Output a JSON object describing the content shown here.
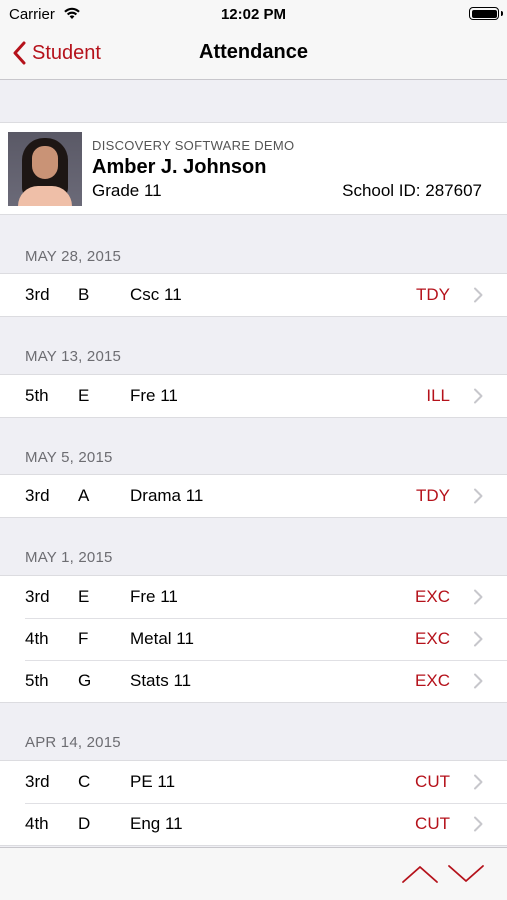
{
  "status_bar": {
    "carrier": "Carrier",
    "time": "12:02 PM",
    "battery_level": 1.0
  },
  "nav": {
    "back_label": "Student",
    "title": "Attendance"
  },
  "student": {
    "school": "DISCOVERY SOFTWARE DEMO",
    "name": "Amber J. Johnson",
    "grade": "Grade 11",
    "school_id": "School ID: 287607"
  },
  "sections": [
    {
      "date": "MAY 28, 2015",
      "rows": [
        {
          "period": "3rd",
          "block": "B",
          "course": "Csc 11",
          "code": "TDY"
        }
      ]
    },
    {
      "date": "MAY 13, 2015",
      "rows": [
        {
          "period": "5th",
          "block": "E",
          "course": "Fre 11",
          "code": "ILL"
        }
      ]
    },
    {
      "date": "MAY 5, 2015",
      "rows": [
        {
          "period": "3rd",
          "block": "A",
          "course": "Drama 11",
          "code": "TDY"
        }
      ]
    },
    {
      "date": "MAY 1, 2015",
      "rows": [
        {
          "period": "3rd",
          "block": "E",
          "course": "Fre 11",
          "code": "EXC"
        },
        {
          "period": "4th",
          "block": "F",
          "course": "Metal 11",
          "code": "EXC"
        },
        {
          "period": "5th",
          "block": "G",
          "course": "Stats 11",
          "code": "EXC"
        }
      ]
    },
    {
      "date": "APR 14, 2015",
      "rows": [
        {
          "period": "3rd",
          "block": "C",
          "course": "PE 11",
          "code": "CUT"
        },
        {
          "period": "4th",
          "block": "D",
          "course": "Eng 11",
          "code": "CUT"
        }
      ]
    }
  ],
  "colors": {
    "accent": "#b5121b",
    "background": "#efeff4",
    "bar": "#f7f7f7"
  },
  "icons": {
    "back": "chevron-left-icon",
    "wifi": "wifi-icon",
    "battery": "battery-icon",
    "row": "chevron-right-icon",
    "up": "arrow-up-icon",
    "down": "arrow-down-icon"
  }
}
